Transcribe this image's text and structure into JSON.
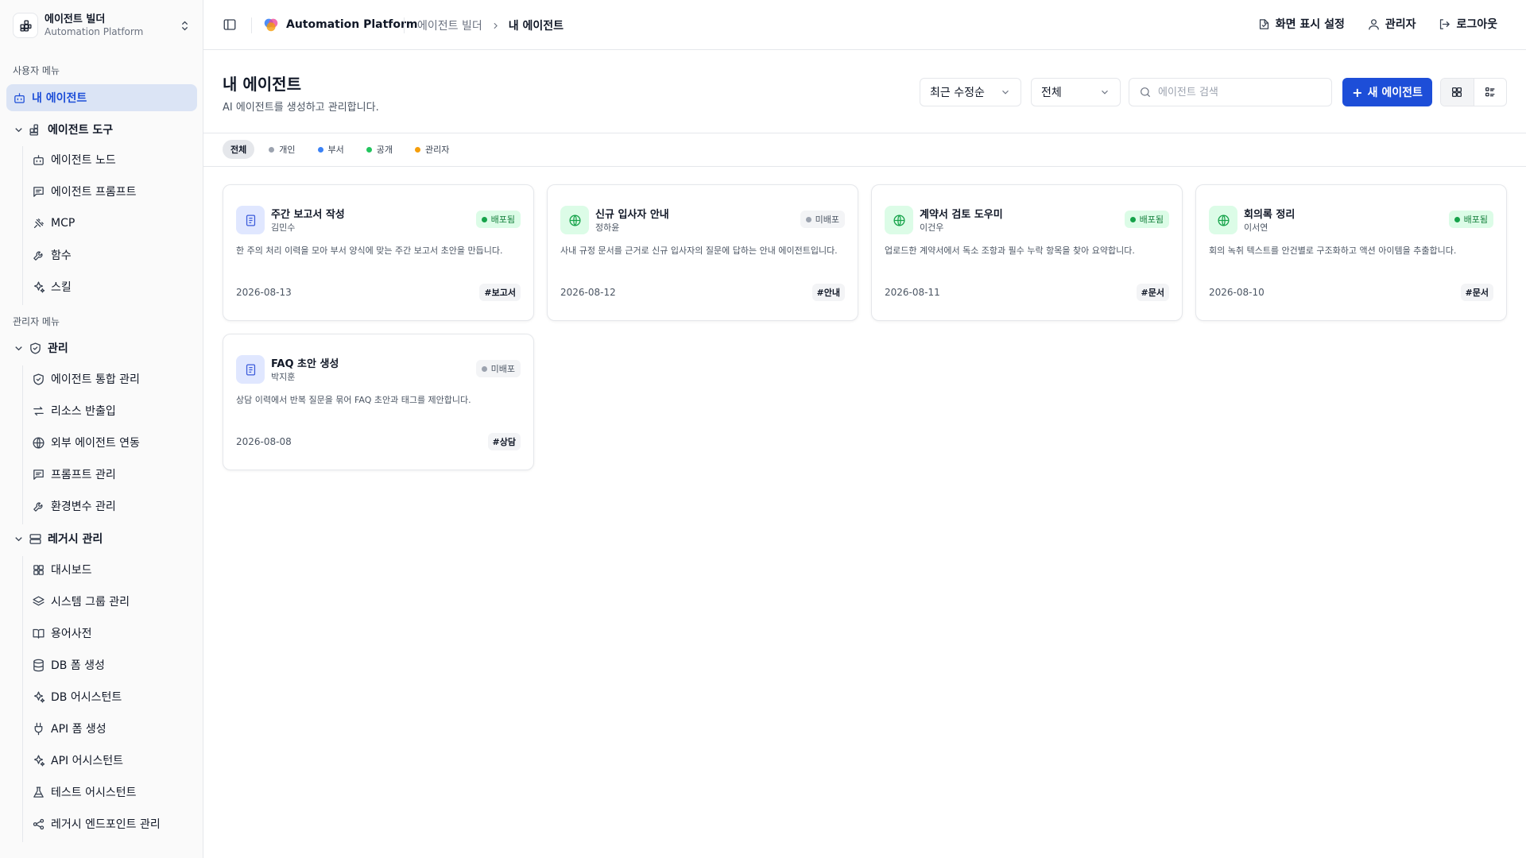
{
  "workspace": {
    "name": "에이전트 빌더",
    "subtitle": "Automation Platform"
  },
  "sidebar": {
    "user_menu_label": "사용자 메뉴",
    "admin_menu_label": "관리자 메뉴",
    "my_agents": "내 에이전트",
    "agent_tools": {
      "label": "에이전트 도구",
      "items": [
        "에이전트 노드",
        "에이전트 프롬프트",
        "MCP",
        "함수",
        "스킬"
      ]
    },
    "manage": {
      "label": "관리",
      "items": [
        "에이전트 통합 관리",
        "리소스 반출입",
        "외부 에이전트 연동",
        "프롬프트 관리",
        "환경변수 관리"
      ]
    },
    "legacy": {
      "label": "레거시 관리",
      "items": [
        "대시보드",
        "시스템 그룹 관리",
        "용어사전",
        "DB 폼 생성",
        "DB 어시스턴트",
        "API 폼 생성",
        "API 어시스턴트",
        "테스트 어시스턴트",
        "레거시 엔드포인트 관리"
      ]
    }
  },
  "header": {
    "brand": "Automation Platform",
    "breadcrumb": {
      "parent": "에이전트 빌더",
      "current": "내 에이전트"
    },
    "display_settings": "화면 표시 설정",
    "user": "관리자",
    "logout": "로그아웃"
  },
  "page": {
    "title": "내 에이전트",
    "description": "AI 에이전트를 생성하고 관리합니다.",
    "sort_value": "최근 수정순",
    "scope_value": "전체",
    "search_placeholder": "에이전트 검색",
    "new_button": "새 에이전트"
  },
  "filters": [
    {
      "label": "전체",
      "color": ""
    },
    {
      "label": "개인",
      "color": "#9ca3af"
    },
    {
      "label": "부서",
      "color": "#3b82f6"
    },
    {
      "label": "공개",
      "color": "#22c55e"
    },
    {
      "label": "관리자",
      "color": "#f59e0b"
    }
  ],
  "cards": [
    {
      "title": "주간 보고서 작성",
      "owner": "김민수",
      "status": "배포됨",
      "status_type": "ok",
      "icon": "document-icon",
      "description": "한 주의 처리 이력을 모아 부서 양식에 맞는 주간 보고서 초안을 만듭니다.",
      "date": "2026-08-13",
      "tag": "#보고서"
    },
    {
      "title": "신규 입사자 안내",
      "owner": "정하윤",
      "status": "미배포",
      "status_type": "draft",
      "icon": "globe-icon",
      "description": "사내 규정 문서를 근거로 신규 입사자의 질문에 답하는 안내 에이전트입니다.",
      "date": "2026-08-12",
      "tag": "#안내"
    },
    {
      "title": "계약서 검토 도우미",
      "owner": "이건우",
      "status": "배포됨",
      "status_type": "ok",
      "icon": "globe-icon",
      "description": "업로드한 계약서에서 독소 조항과 필수 누락 항목을 찾아 요약합니다.",
      "date": "2026-08-11",
      "tag": "#문서"
    },
    {
      "title": "회의록 정리",
      "owner": "이서연",
      "status": "배포됨",
      "status_type": "ok",
      "icon": "globe-icon",
      "description": "회의 녹취 텍스트를 안건별로 구조화하고 액션 아이템을 추출합니다.",
      "date": "2026-08-10",
      "tag": "#문서"
    },
    {
      "title": "FAQ 초안 생성",
      "owner": "박지훈",
      "status": "미배포",
      "status_type": "draft",
      "icon": "document-icon",
      "description": "상담 이력에서 반복 질문을 묶어 FAQ 초안과 태그를 제안합니다.",
      "date": "2026-08-08",
      "tag": "#상담"
    }
  ]
}
